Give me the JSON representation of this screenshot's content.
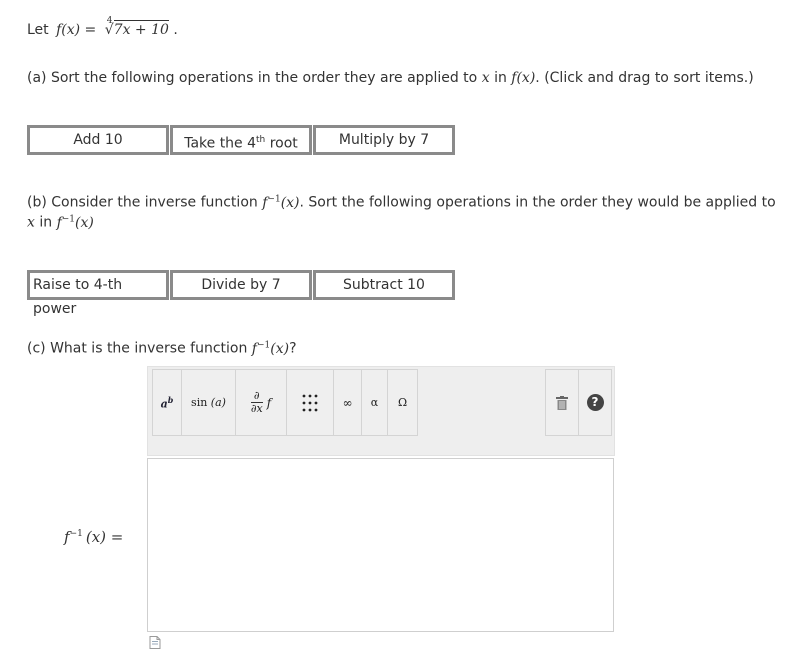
{
  "intro": {
    "prefix": "Let",
    "f_lhs": "f(x) =",
    "radical_index": "4",
    "radicand": "7x + 10",
    "suffix": "."
  },
  "part_a": {
    "text_1": "(a) Sort the following operations in the order they are applied to",
    "var": "x",
    "text_2": "in",
    "fn": "f(x)",
    "text_3": ". (Click and drag to sort items.)",
    "items": [
      {
        "label": "Add 10"
      },
      {
        "label_pre": "Take the 4",
        "label_sup": "th",
        "label_post": " root"
      },
      {
        "label": "Multiply by 7"
      }
    ]
  },
  "part_b": {
    "text_1": "(b) Consider the inverse function",
    "fn": "f",
    "fn_sup": "−1",
    "fn_arg": "(x)",
    "text_2": ". Sort the following operations in the order they would be applied to",
    "var": "x",
    "text_3": "in",
    "fn2": "f",
    "fn2_sup": "−1",
    "fn2_arg": "(x)",
    "items": [
      {
        "label": "Raise to 4-th power"
      },
      {
        "label": "Divide by 7"
      },
      {
        "label": "Subtract 10"
      }
    ]
  },
  "part_c": {
    "text_1": "(c) What is the inverse function",
    "fn": "f",
    "fn_sup": "−1",
    "fn_arg": "(x)",
    "text_2": "?",
    "answer_label": "f",
    "answer_sup": "−1",
    "answer_rest": "(x) =",
    "toolbar": {
      "exponent_base": "a",
      "exponent_sup": "b",
      "sin_label": "sin",
      "sin_arg": "(a)",
      "deriv_num": "∂",
      "deriv_den": "∂x",
      "deriv_f": "f",
      "matrix_icon": "grid-dots-icon",
      "infinity": "∞",
      "alpha": "α",
      "omega": "Ω",
      "trash_icon": "trash-icon",
      "help": "?"
    }
  }
}
